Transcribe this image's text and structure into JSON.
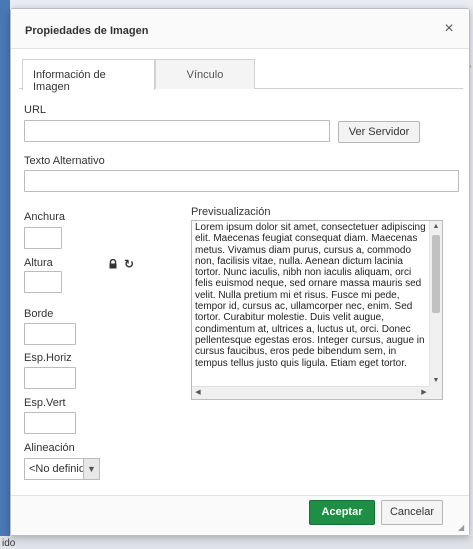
{
  "dialog": {
    "title": "Propiedades de Imagen",
    "close_glyph": "×"
  },
  "tabs": [
    {
      "label": "Información de Imagen",
      "active": true
    },
    {
      "label": "Vínculo",
      "active": false
    }
  ],
  "fields": {
    "url_label": "URL",
    "url_value": "",
    "browse_server_label": "Ver Servidor",
    "alt_label": "Texto Alternativo",
    "alt_value": "",
    "width_label": "Anchura",
    "height_label": "Altura",
    "border_label": "Borde",
    "hspace_label": "Esp.Horiz",
    "vspace_label": "Esp.Vert",
    "align_label": "Alineación",
    "align_value": "<No definido>"
  },
  "icons": {
    "lock": "lock-icon",
    "reset": "reset-size-icon",
    "reset_glyph": "↻"
  },
  "preview": {
    "label": "Previsualización",
    "text": "Lorem ipsum dolor sit amet, consectetuer adipiscing elit. Maecenas feugiat consequat diam. Maecenas metus. Vivamus diam purus, cursus a, commodo non, facilisis vitae, nulla. Aenean dictum lacinia tortor. Nunc iaculis, nibh non iaculis aliquam, orci felis euismod neque, sed ornare massa mauris sed velit. Nulla pretium mi et risus. Fusce mi pede, tempor id, cursus ac, ullamcorper nec, enim. Sed tortor. Curabitur molestie. Duis velit augue, condimentum at, ultrices a, luctus ut, orci. Donec pellentesque egestas eros. Integer cursus, augue in cursus faucibus, eros pede bibendum sem, in tempus tellus justo quis ligula. Etiam eget tortor."
  },
  "footer": {
    "ok_label": "Aceptar",
    "cancel_label": "Cancelar"
  },
  "background": {
    "bottom_text": "ido",
    "right_text": "o"
  },
  "colors": {
    "accent_green": "#1f8f45",
    "side_strip_blue": "#4a78b5"
  }
}
